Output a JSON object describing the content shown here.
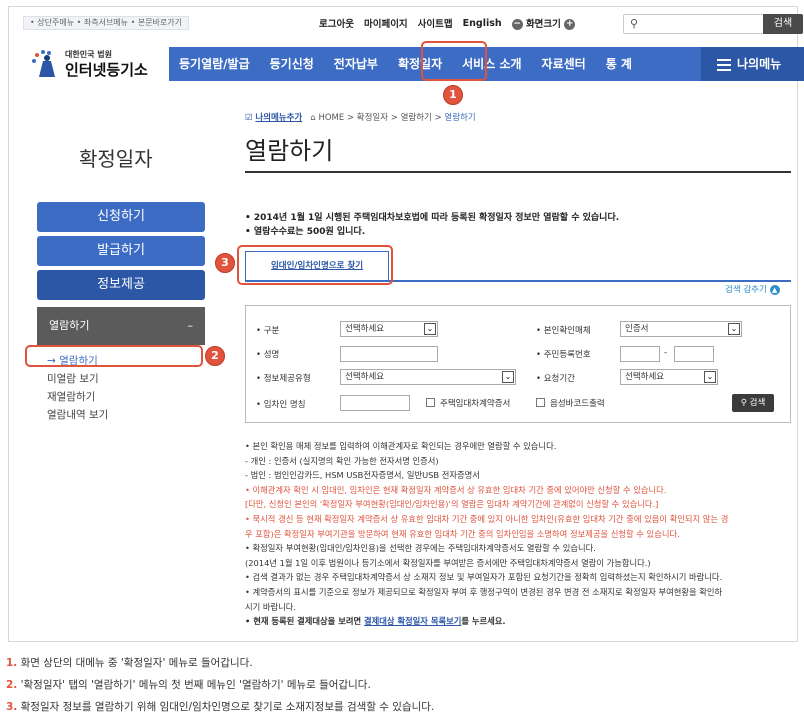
{
  "header": {
    "skip_links": "• 상단주메뉴 • 좌측서브메뉴 • 본문바로가기",
    "util": {
      "logout": "로그아웃",
      "mypage": "마이페이지",
      "sitemap": "사이트맵",
      "english": "English",
      "screen_size": "화면크기"
    },
    "search_button": "검색",
    "logo": {
      "small": "대한민국 법원",
      "large": "인터넷등기소"
    }
  },
  "gnb": {
    "items": [
      "등기열람/발급",
      "등기신청",
      "전자납부",
      "확정일자",
      "서비스 소개",
      "자료센터",
      "통 계"
    ],
    "my_menu": "나의메뉴"
  },
  "sidebar": {
    "title": "확정일자",
    "nav": [
      "신청하기",
      "발급하기",
      "정보제공"
    ],
    "sub_header": "열람하기",
    "sub_toggle": "–",
    "sub_items": [
      "→ 열람하기",
      "미열람 보기",
      "재열람하기",
      "열람내역 보기"
    ]
  },
  "breadcrumb": {
    "fav": "나의메뉴추가",
    "home": "HOME",
    "path": "> 확정일자 > 열람하기 >",
    "current": "열람하기"
  },
  "page_title": "열람하기",
  "notices": [
    "• 2014년 1월 1일 시행된 주택임대차보호법에 따라 등록된 확정일자 정보만 열람할 수 있습니다.",
    "• 열람수수료는 500원 입니다."
  ],
  "tab_label": "임대인/임차인명으로 찾기",
  "collapse_label": "검색 감추기",
  "form": {
    "labels": {
      "type": "• 구분",
      "name": "• 성명",
      "info_type": "• 정보제공유형",
      "tenant_name": "• 임차인 명칭",
      "id_method": "• 본인확인매체",
      "resident_no": "• 주민등록번호",
      "period": "• 요청기간"
    },
    "type_value": "선택하세요",
    "info_type_value": "선택하세요",
    "id_method_value": "인증서",
    "period_value": "선택하세요",
    "resident_sep": "-",
    "chk_contract": "주택임대차계약증서",
    "chk_barcode": "음성바코드출력",
    "search_btn": "검색"
  },
  "info_lines": [
    {
      "t": "• 본인 확인용 매체 정보를 입력하여 이해관계자로 확인되는 경우에만 열람할 수 있습니다.",
      "c": ""
    },
    {
      "t": "  - 개인 : 인증서 (실지명의 확인 가능한 전자서명 인증서)",
      "c": ""
    },
    {
      "t": "  - 법인 : 법인인감카드, HSM USB전자증명서, 일반USB 전자증명서",
      "c": ""
    },
    {
      "t": "• 이해관계자 확인 시 임대인, 임차인은 현재 확정일자 계약증서 상 유효한 임대차 기간 중에 있어야만 신청할 수 있습니다.",
      "c": "r"
    },
    {
      "t": "  [다만, 신청인 본인의 '확정일자 부여현황(임대인/임차인용)'의 열람은 임대차 계약기간에 관계없이 신청할 수 있습니다.]",
      "c": "r"
    },
    {
      "t": "• 묵시적 갱신 등 현재 확정일자 계약증서 상 유효한 임대차 기간 중에 있지 아니한 임차인(유효한 임대차 기간 중에 있음이 확인되지 않는 경",
      "c": "r"
    },
    {
      "t": "  우 포함)은 확정일자 부여기관을 방문하여 현재 유효한 임대차 기간 중의 임차인임을 소명하여 정보제공을 신청할 수 있습니다.",
      "c": "r"
    },
    {
      "t": "• 확정일자 부여현황(임대인/임차인용)을 선택한 경우에는 주택임대차계약증서도 열람할 수 있습니다.",
      "c": ""
    },
    {
      "t": "  (2014년 1월 1일 이후 법원이나 등기소에서 확정일자를 부여받은 증서에만 주택임대차계약증서 열람이 가능합니다.)",
      "c": ""
    },
    {
      "t": "• 검색 결과가 없는 경우 주택임대차계약증서 상 소재지 정보 및 부여일자가 포함된 요청기간을 정확히 입력하셨는지 확인하시기 바랍니다.",
      "c": ""
    },
    {
      "t": "• 계약증서의 표시를 기준으로 정보가 제공되므로 확정일자 부여 후 행정구역이 변경된 경우 변경 전 소재지로 확정일자 부여현황을 확인하",
      "c": ""
    },
    {
      "t": "  시기 바랍니다.",
      "c": ""
    }
  ],
  "last_info": {
    "pre": "• 현재 등록된 결제대상을 보려면 ",
    "link": "결제대상 확정일자 목록보기",
    "post": "를 누르세요."
  },
  "markers": [
    "1",
    "2",
    "3"
  ],
  "captions": [
    {
      "n": "1.",
      "t": " 화면 상단의 대메뉴 중 '확정일자' 메뉴로 들어갑니다."
    },
    {
      "n": "2.",
      "t": " '확정일자' 탭의 '열람하기' 메뉴의 첫 번째 메뉴인 '열람하기' 메뉴로 들어갑니다."
    },
    {
      "n": "3.",
      "t": " 확정일자 정보를 열람하기 위해 임대인/임차인명으로 찾기로 소재지정보를 검색할 수 있습니다."
    }
  ],
  "colors": {
    "primary": "#3d6cc4",
    "highlight": "#e0533d",
    "dark": "#2c56a6"
  }
}
